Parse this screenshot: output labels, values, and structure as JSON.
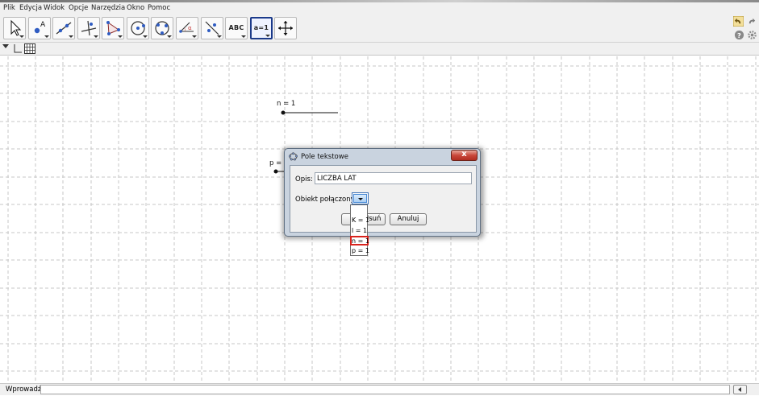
{
  "menubar": {
    "items": [
      "Plik",
      "Edycja",
      "Widok",
      "Opcje",
      "Narzędzia",
      "Okno",
      "Pomoc"
    ]
  },
  "toolbar": {
    "tools": [
      {
        "name": "move-tool",
        "icon": "arrow-icon"
      },
      {
        "name": "point-tool",
        "icon": "point-icon"
      },
      {
        "name": "line-tool",
        "icon": "line-icon"
      },
      {
        "name": "perpendicular-line-tool",
        "icon": "perpendicular-icon"
      },
      {
        "name": "polygon-tool",
        "icon": "polygon-icon"
      },
      {
        "name": "circle-tool",
        "icon": "circle-center-icon"
      },
      {
        "name": "circle-three-points-tool",
        "icon": "circle-points-icon"
      },
      {
        "name": "angle-tool",
        "icon": "angle-icon"
      },
      {
        "name": "reflect-tool",
        "icon": "reflect-icon"
      },
      {
        "name": "text-tool",
        "icon": "text-icon",
        "label": "ABC"
      },
      {
        "name": "slider-tool",
        "icon": "slider-icon",
        "label": "a=1"
      },
      {
        "name": "move-graphics-view-tool",
        "icon": "move-view-icon"
      }
    ]
  },
  "canvas": {
    "slider_n_label": "n = 1",
    "slider_p_label": "p = 1"
  },
  "dialog": {
    "title": "Pole tekstowe",
    "close_label": "x",
    "opis_label": "Opis:",
    "opis_value": "LICZBA LAT",
    "obiekt_label": "Obiekt połączony:",
    "ok_label": "OK",
    "cancel_label": "Anuluj",
    "ok_overlay_text": "Usuń",
    "dropdown_items": [
      "",
      "K = 1",
      "l = 1",
      "n = 1",
      "p = 1"
    ],
    "selected_item": "n = 1"
  },
  "inputbar": {
    "label": "Wprowadź:",
    "value": ""
  }
}
